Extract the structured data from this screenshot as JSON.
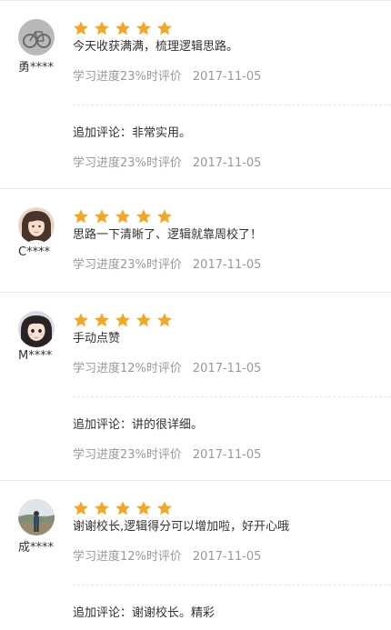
{
  "accent_color": "#f5a623",
  "reviews": [
    {
      "username": "勇****",
      "avatar_icon": "bicycle-avatar-icon",
      "rating": 5,
      "text": "今天收获满满，梳理逻辑思路。",
      "progress": "学习进度23%时评价",
      "date": "2017-11-05",
      "append": {
        "text": "追加评论：非常实用。",
        "progress": "学习进度23%时评价",
        "date": "2017-11-05"
      }
    },
    {
      "username": "C****",
      "avatar_icon": "girl-avatar-icon",
      "rating": 5,
      "text": "思路一下清晰了、逻辑就靠周校了！",
      "progress": "学习进度23%时评价",
      "date": "2017-11-05"
    },
    {
      "username": "M****",
      "avatar_icon": "girl-avatar-icon",
      "rating": 5,
      "text": "手动点赞",
      "progress": "学习进度12%时评价",
      "date": "2017-11-05",
      "append": {
        "text": "追加评论：讲的很详细。",
        "progress": "学习进度23%时评价",
        "date": "2017-11-05"
      }
    },
    {
      "username": "成****",
      "avatar_icon": "landscape-avatar-icon",
      "rating": 5,
      "text": "谢谢校长,逻辑得分可以增加啦，好开心哦",
      "progress": "学习进度12%时评价",
      "date": "2017-11-05",
      "append": {
        "text": "追加评论：谢谢校长。精彩"
      }
    }
  ]
}
